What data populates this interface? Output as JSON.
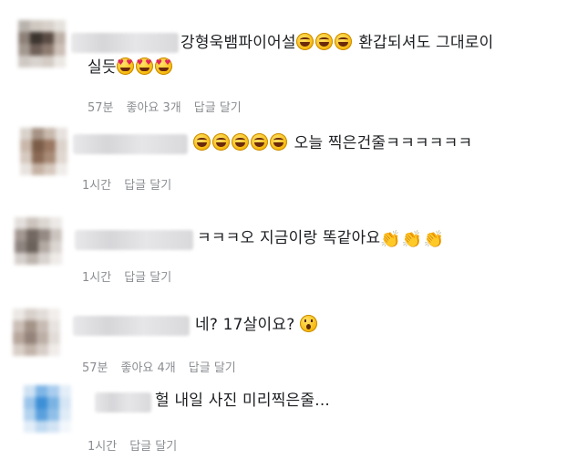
{
  "comments": [
    {
      "line1": "강형욱뱀파이어설",
      "line1_after": "환갑되셔도 그대로이",
      "line2": "실듯",
      "emojis1": [
        "laugh",
        "laugh",
        "laugh"
      ],
      "emojis2": [
        "heart-eyes",
        "heart-eyes",
        "heart-eyes"
      ],
      "meta": {
        "time": "57분",
        "likes": "좋아요 3개",
        "reply": "답글 달기"
      }
    },
    {
      "text": "오늘 찍은건줄ㅋㅋㅋㅋㅋㅋ",
      "emojis": [
        "laugh",
        "laugh",
        "laugh",
        "laugh",
        "laugh"
      ],
      "meta": {
        "time": "1시간",
        "reply": "답글 달기"
      }
    },
    {
      "text": "ㅋㅋㅋ오 지금이랑 똑같아요",
      "emojis": [
        "clapping-hands",
        "clapping-hands",
        "clapping-hands"
      ],
      "meta": {
        "time": "1시간",
        "reply": "답글 달기"
      }
    },
    {
      "text": "네? 17살이요?",
      "emojis": [
        "astonished-face"
      ],
      "meta": {
        "time": "57분",
        "likes": "좋아요 4개",
        "reply": "답글 달기"
      }
    },
    {
      "text": "헐 내일 사진 미리찍은줄...",
      "meta": {
        "time": "1시간",
        "reply": "답글 달기"
      }
    }
  ],
  "colors": {
    "text": "#1c1e21",
    "meta": "#8a8d91",
    "emoji_yellow": "#f5b400"
  }
}
